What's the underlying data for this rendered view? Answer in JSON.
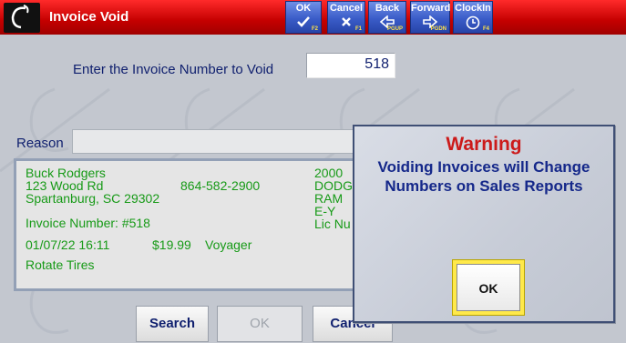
{
  "window": {
    "title": "Invoice Void"
  },
  "toolbar": {
    "buttons": [
      {
        "label": "OK",
        "icon": "check-icon",
        "key": "F2"
      },
      {
        "label": "Cancel",
        "icon": "x-icon",
        "key": "F1"
      },
      {
        "label": "Back",
        "icon": "arrow-left-icon",
        "key": "PGUP"
      },
      {
        "label": "Forward",
        "icon": "arrow-right-icon",
        "key": "PGDN"
      },
      {
        "label": "ClockIn",
        "icon": "clock-icon",
        "key": "F4"
      }
    ]
  },
  "form": {
    "invoice_label": "Enter the Invoice Number to Void",
    "invoice_value": "518",
    "reason_label": "Reason",
    "reason_value": ""
  },
  "invoice_info": {
    "customer_name": "Buck Rodgers",
    "address1": "123 Wood Rd",
    "phone": "864-582-2900",
    "address2": "Spartanburg, SC 29302",
    "invoice_number": "Invoice Number: #518",
    "datetime": "01/07/22 16:11",
    "amount": "$19.99",
    "vehicle": "Voyager",
    "service": "Rotate Tires",
    "vehicle_year": "2000",
    "vehicle_make": "DODG",
    "vehicle_model": "RAM",
    "vehicle_trim": "E-Y",
    "license": "Lic Nu"
  },
  "buttons": {
    "search": "Search",
    "ok": "OK",
    "cancel": "Cancel"
  },
  "dialog": {
    "title": "Warning",
    "message": "Voiding Invoices will Change Numbers on Sales Reports",
    "ok_label": "OK"
  },
  "colors": {
    "titlebar": "#c40000",
    "toolbar_button": "#3a5cc8",
    "info_text": "#179a17",
    "warning_title": "#cc1a1a",
    "warning_text": "#15288a",
    "ok_highlight": "#ffe94a"
  }
}
